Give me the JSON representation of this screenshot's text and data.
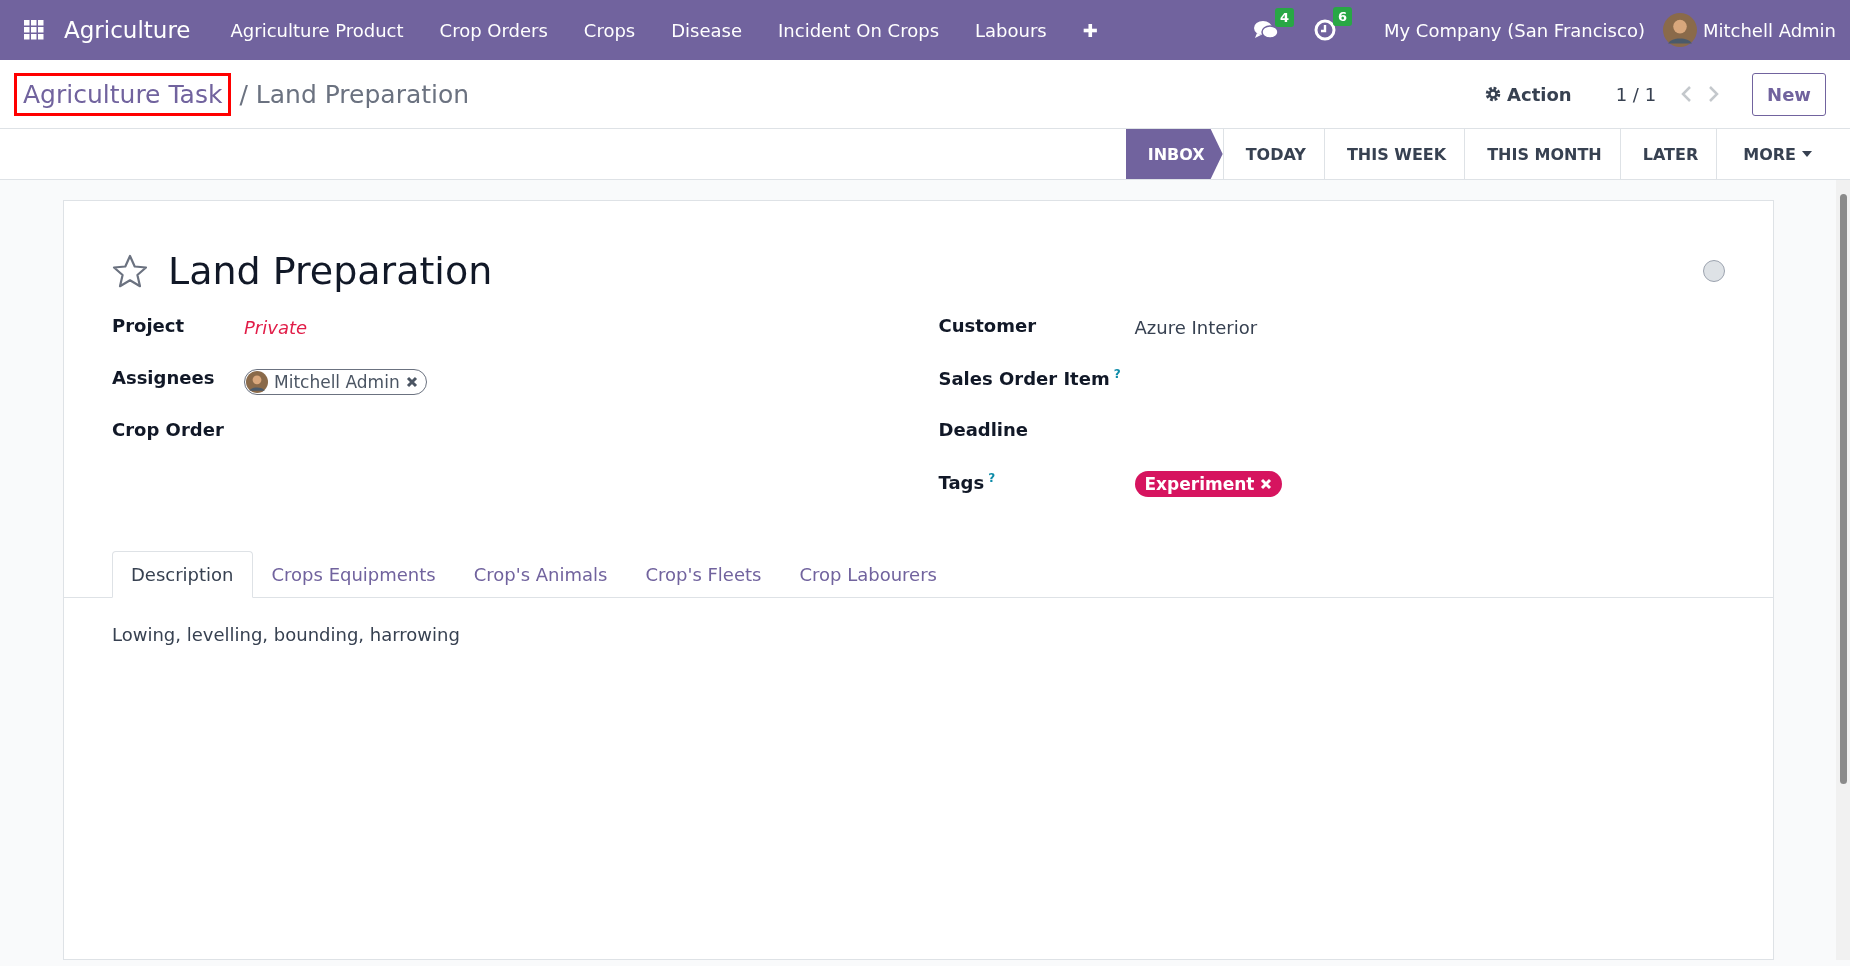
{
  "navbar": {
    "app_name": "Agriculture",
    "menu": [
      "Agriculture Product",
      "Crop Orders",
      "Crops",
      "Disease",
      "Incident On Crops",
      "Labours",
      "✚"
    ],
    "notifications": [
      {
        "kind": "chat",
        "count": "4"
      },
      {
        "kind": "clock",
        "count": "6"
      }
    ],
    "company": "My Company (San Francisco)",
    "user": "Mitchell Admin"
  },
  "control_panel": {
    "breadcrumb": [
      {
        "label": "Agriculture Task",
        "highlighted": true
      }
    ],
    "separator": "/",
    "current": "Land Preparation",
    "action": "Action",
    "pager": "1 / 1",
    "new_button": "New"
  },
  "stages": [
    {
      "label": "INBOX",
      "selected": true
    },
    {
      "label": "TODAY",
      "selected": false
    },
    {
      "label": "THIS WEEK",
      "selected": false
    },
    {
      "label": "THIS MONTH",
      "selected": false
    },
    {
      "label": "LATER",
      "selected": false
    }
  ],
  "more": "MORE",
  "form": {
    "title": "Land Preparation",
    "starred": false,
    "done": false,
    "left_fields": [
      {
        "label": "Project",
        "help": false,
        "kind": "placeholder",
        "value": "Private"
      },
      {
        "label": "Assignees",
        "help": false,
        "kind": "avatar_tag",
        "value": "Mitchell Admin"
      },
      {
        "label": "Crop Order",
        "help": false,
        "kind": "empty"
      }
    ],
    "right_fields": [
      {
        "label": "Customer",
        "help": false,
        "kind": "text",
        "value": "Azure Interior"
      },
      {
        "label": "Sales Order Item",
        "help": true,
        "kind": "empty"
      },
      {
        "label": "Deadline",
        "help": false,
        "kind": "empty"
      },
      {
        "label": "Tags",
        "help": true,
        "kind": "tag",
        "value": "Experiment",
        "color": "#d6145f"
      }
    ],
    "help_mark": "?",
    "tabs": [
      {
        "label": "Description",
        "selected": true
      },
      {
        "label": "Crops Equipments",
        "selected": false
      },
      {
        "label": "Crop's Animals",
        "selected": false
      },
      {
        "label": "Crop's Fleets",
        "selected": false
      },
      {
        "label": "Crop Labourers",
        "selected": false
      }
    ],
    "description": "Lowing, levelling, bounding, harrowing"
  }
}
